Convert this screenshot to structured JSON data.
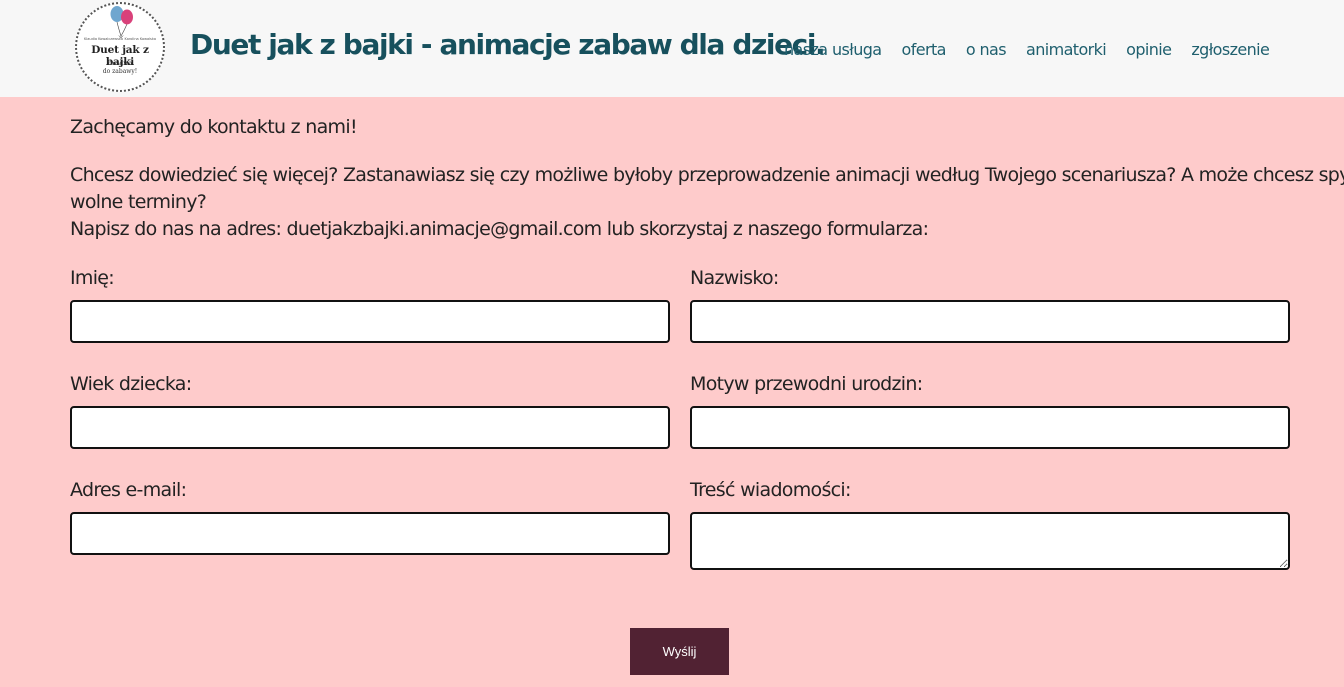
{
  "header": {
    "logo": {
      "top_left": "Klaudia Kowalczewska",
      "top_right": "Karolina Kowalska",
      "name": "Duet jak z bajki",
      "tagline": "raz-dwa\ndo zabawy!"
    },
    "title": "Duet jak z bajki - animacje zabaw dla dzieci.",
    "nav": [
      "nasza usługa",
      "oferta",
      "o nas",
      "animatorki",
      "opinie",
      "zgłoszenie"
    ]
  },
  "intro": {
    "line1": "Zachęcamy do kontaktu z nami!",
    "line2": "Chcesz dowiedzieć się więcej? Zastanawiasz się czy możliwe byłoby przeprowadzenie animacji według Twojego scenariusza? A może chcesz spytać o",
    "line3": "wolne terminy?",
    "line4": "Napisz do nas na adres: duetjakzbajki.animacje@gmail.com lub skorzystaj z naszego formularza:"
  },
  "form": {
    "first_name_label": "Imię:",
    "last_name_label": "Nazwisko:",
    "child_age_label": "Wiek dziecka:",
    "theme_label": "Motyw przewodni urodzin:",
    "email_label": "Adres e-mail:",
    "message_label": "Treść wiadomości:",
    "first_name_value": "",
    "last_name_value": "",
    "child_age_value": "",
    "theme_value": "",
    "email_value": "",
    "message_value": "",
    "submit_label": "Wyślij"
  },
  "colors": {
    "header_bg": "#f7f7f7",
    "page_bg": "#fecbcb",
    "title": "#17505d",
    "nav": "#1f5f6e",
    "button_bg": "#512233"
  }
}
